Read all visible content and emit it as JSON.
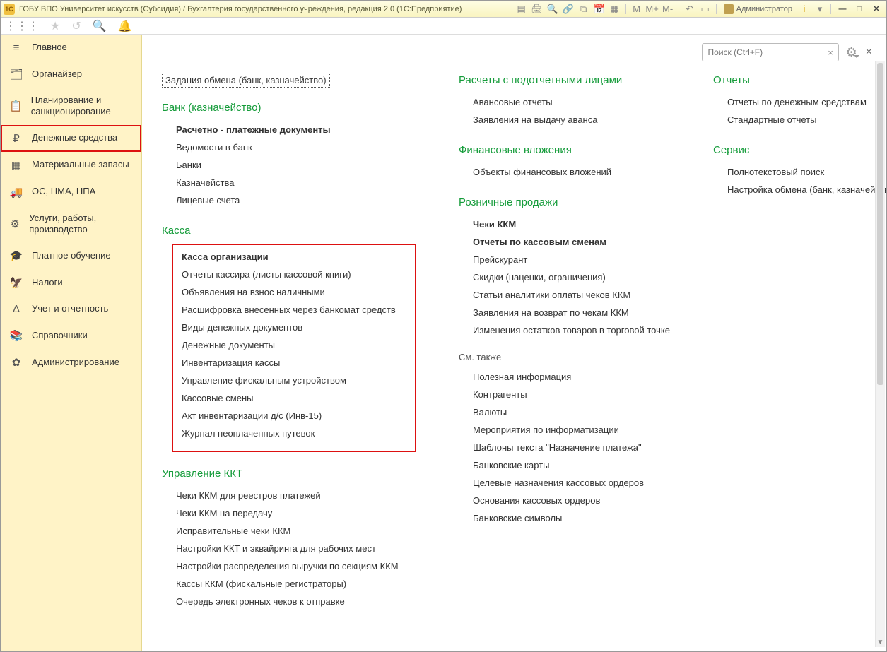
{
  "titlebar": {
    "app_icon_text": "1C",
    "title": "ГОБУ ВПО Университет искусств (Субсидия) / Бухгалтерия государственного учреждения, редакция 2.0  (1С:Предприятие)",
    "calc_m": "M",
    "calc_mplus": "M+",
    "calc_mminus": "M-",
    "admin_label": "Администратор",
    "info_i": "i",
    "minimize": "—",
    "maximize": "□",
    "close": "✕"
  },
  "topstrip": {
    "grid": "⋮⋮⋮",
    "star": "★",
    "history": "↺",
    "search": "🔍",
    "bell": "🔔"
  },
  "sidebar": {
    "items": [
      {
        "icon": "≡",
        "label": "Главное",
        "name": "main"
      },
      {
        "icon": "🗂",
        "label": "Органайзер",
        "name": "organizer"
      },
      {
        "icon": "📋",
        "label": "Планирование и санкционирование",
        "name": "planning"
      },
      {
        "icon": "₽",
        "label": "Денежные средства",
        "name": "cash",
        "active": true
      },
      {
        "icon": "▦",
        "label": "Материальные запасы",
        "name": "materials"
      },
      {
        "icon": "🚚",
        "label": "ОС, НМА, НПА",
        "name": "assets"
      },
      {
        "icon": "⚙",
        "label": "Услуги, работы, производство",
        "name": "services"
      },
      {
        "icon": "🎓",
        "label": "Платное обучение",
        "name": "education"
      },
      {
        "icon": "🦅",
        "label": "Налоги",
        "name": "taxes"
      },
      {
        "icon": "Δ",
        "label": "Учет и отчетность",
        "name": "accounting"
      },
      {
        "icon": "📚",
        "label": "Справочники",
        "name": "references"
      },
      {
        "icon": "✿",
        "label": "Администрирование",
        "name": "administration"
      }
    ]
  },
  "content": {
    "search_placeholder": "Поиск (Ctrl+F)",
    "search_clear": "×",
    "close_x": "×",
    "boxed_top_link": "Задания обмена (банк, казначейство)",
    "col1": {
      "bank_h": "Банк (казначейство)",
      "bank_items": [
        "Расчетно - платежные документы",
        "Ведомости в банк",
        "Банки",
        "Казначейства",
        "Лицевые счета"
      ],
      "kassa_h": "Касса",
      "kassa_items": [
        "Касса организации",
        "Отчеты кассира (листы кассовой книги)",
        "Объявления на взнос наличными",
        "Расшифровка внесенных через банкомат средств",
        "Виды денежных документов",
        "Денежные документы",
        "Инвентаризация кассы",
        "Управление фискальным устройством",
        "Кассовые смены",
        "Акт инвентаризации д/с (Инв-15)",
        "Журнал неоплаченных путевок"
      ],
      "kkt_h": "Управление ККТ",
      "kkt_items": [
        "Чеки ККМ для реестров платежей",
        "Чеки ККМ на передачу",
        "Исправительные чеки ККМ",
        "Настройки ККТ и эквайринга для рабочих мест",
        "Настройки распределения выручки по секциям ККМ",
        "Кассы ККМ (фискальные регистраторы)",
        "Очередь электронных чеков к отправке"
      ]
    },
    "col2": {
      "podotchet_h": "Расчеты с подотчетными лицами",
      "podotchet_items": [
        "Авансовые отчеты",
        "Заявления на выдачу аванса"
      ],
      "fin_h": "Финансовые вложения",
      "fin_items": [
        "Объекты финансовых вложений"
      ],
      "retail_h": "Розничные продажи",
      "retail_items": [
        "Чеки ККМ",
        "Отчеты по кассовым сменам",
        "Прейскурант",
        "Скидки (наценки, ограничения)",
        "Статьи аналитики оплаты чеков ККМ",
        "Заявления на возврат по чекам ККМ",
        "Изменения остатков товаров в торговой точке"
      ],
      "see_also_h": "См. также",
      "see_also_items": [
        "Полезная информация",
        "Контрагенты",
        "Валюты",
        "Мероприятия по информатизации",
        "Шаблоны текста \"Назначение платежа\"",
        "Банковские карты",
        "Целевые назначения кассовых ордеров",
        "Основания кассовых ордеров",
        "Банковские символы"
      ]
    },
    "col3": {
      "reports_h": "Отчеты",
      "reports_items": [
        "Отчеты по денежным средствам",
        "Стандартные отчеты"
      ],
      "service_h": "Сервис",
      "service_items": [
        "Полнотекстовый поиск",
        "Настройка обмена (банк, казначейство)"
      ]
    }
  }
}
